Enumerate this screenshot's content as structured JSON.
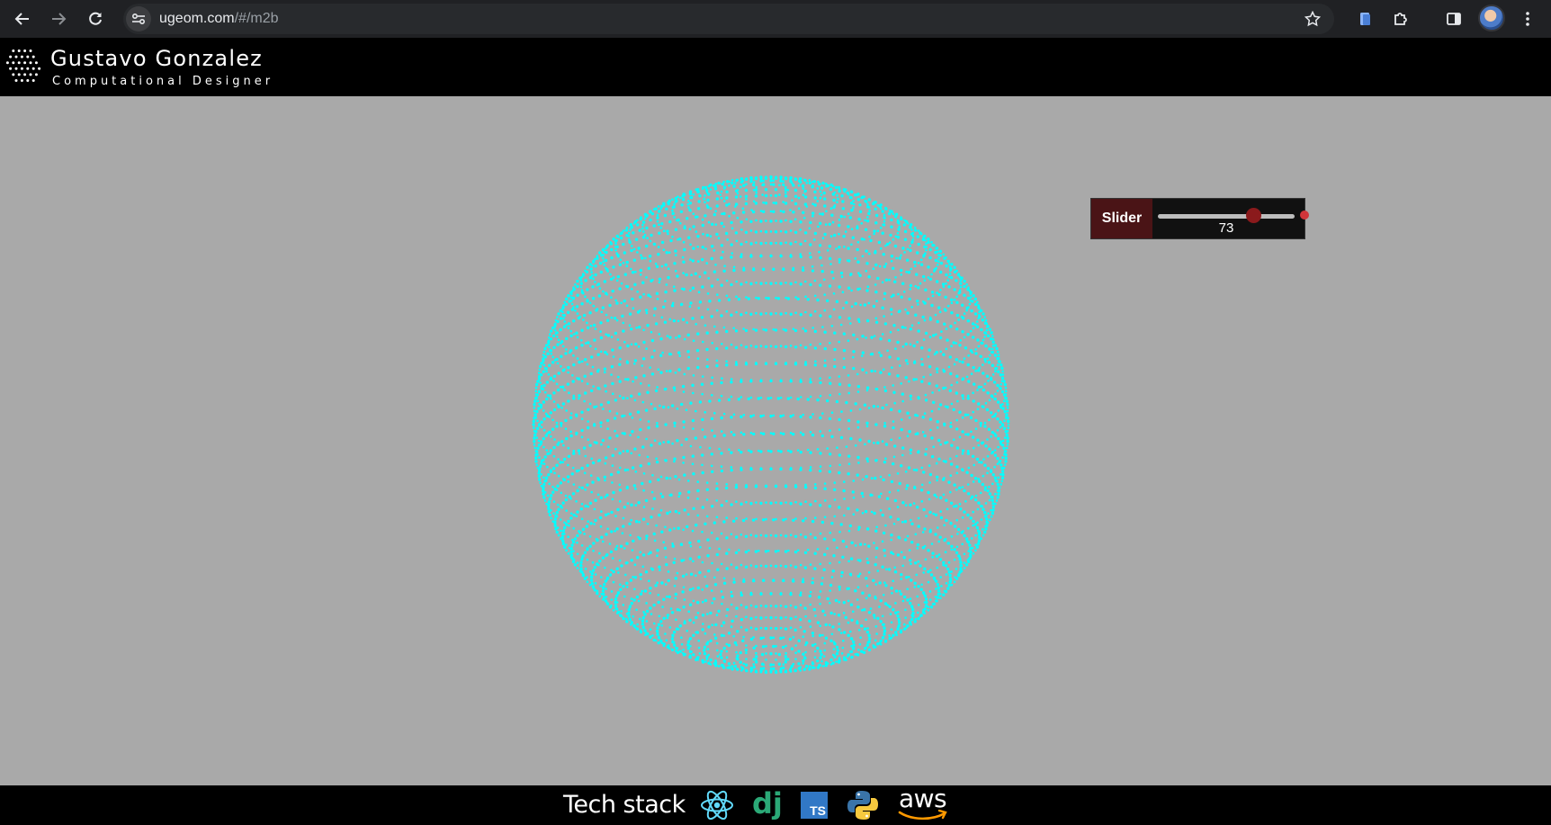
{
  "browser": {
    "url_host": "ugeom.com",
    "url_path": "/#/m2b"
  },
  "header": {
    "name": "Gustavo Gonzalez",
    "role": "Computational Designer"
  },
  "slider": {
    "label": "Slider",
    "value": "73",
    "fraction": 0.7
  },
  "footer": {
    "title": "Tech stack",
    "icons": [
      "react-icon",
      "django-icon",
      "typescript-icon",
      "python-icon",
      "aws-icon"
    ],
    "ts_text": "TS",
    "dj_text": "dj",
    "aws_text": "aws"
  },
  "colors": {
    "points": "#00ffff",
    "background": "#a9a9a9",
    "slider_thumb": "#8b1a1c",
    "slider_label_bg": "#4a1416"
  }
}
